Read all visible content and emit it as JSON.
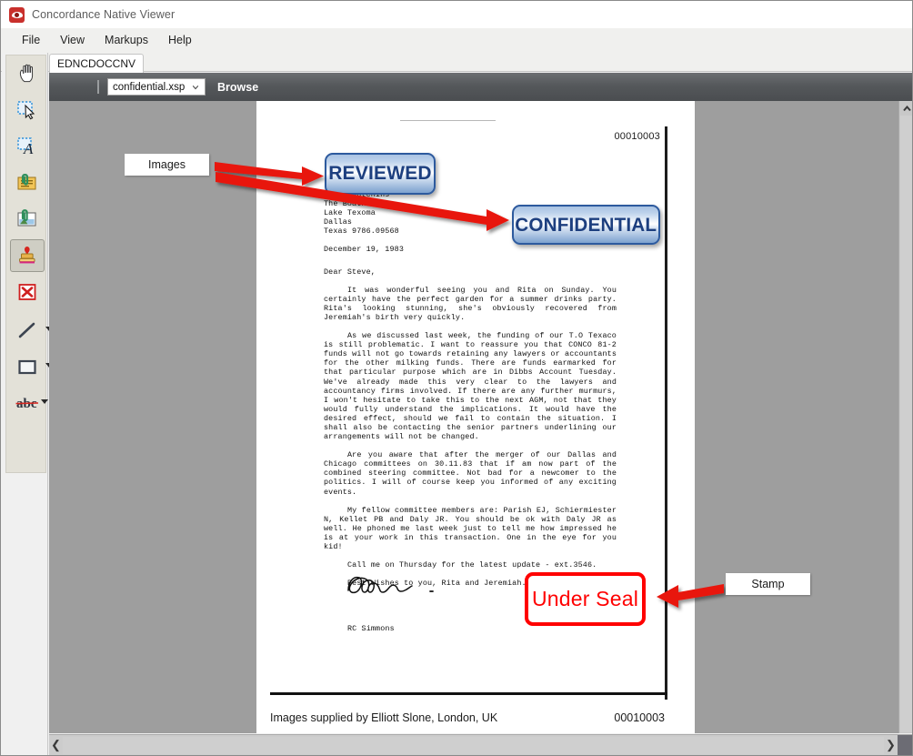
{
  "window": {
    "title": "Concordance Native Viewer",
    "app_icon": "eye-icon"
  },
  "menu": {
    "items": [
      {
        "label": "File",
        "name": "menu-file"
      },
      {
        "label": "View",
        "name": "menu-view"
      },
      {
        "label": "Markups",
        "name": "menu-markups"
      },
      {
        "label": "Help",
        "name": "menu-help"
      }
    ]
  },
  "tabs": [
    {
      "label": "EDNCDOCCNV",
      "active": true
    }
  ],
  "browse_bar": {
    "file_value": "confidential.xsp",
    "browse_label": "Browse",
    "dropdown_icon": "chevron-down-icon"
  },
  "toolbar": {
    "tools": [
      {
        "name": "pan-hand-tool",
        "icon": "hand-icon",
        "selected": false
      },
      {
        "name": "select-region-tool",
        "icon": "select-arrow-icon",
        "selected": false
      },
      {
        "name": "select-text-tool",
        "icon": "text-select-icon",
        "selected": false
      },
      {
        "name": "sticky-note-tool",
        "icon": "note-attach-icon",
        "selected": false
      },
      {
        "name": "image-annotation-tool",
        "icon": "image-stamp-icon",
        "selected": false
      },
      {
        "name": "stamp-tool",
        "icon": "rubber-stamp-icon",
        "selected": true
      },
      {
        "name": "redaction-tool",
        "icon": "red-x-box-icon",
        "selected": false
      },
      {
        "name": "line-tool",
        "icon": "line-icon",
        "selected": false,
        "has_dropdown": true
      },
      {
        "name": "rectangle-tool",
        "icon": "rectangle-icon",
        "selected": false,
        "has_dropdown": true
      },
      {
        "name": "strikeout-tool",
        "icon": "abc-strikeout-icon",
        "selected": false,
        "has_dropdown": true
      }
    ]
  },
  "callouts": [
    {
      "name": "callout-images",
      "label": "Images"
    },
    {
      "name": "callout-stamp",
      "label": "Stamp"
    }
  ],
  "document": {
    "bates_top": "00010003",
    "bates_bottom": "00010003",
    "supplied_by": "Images supplied by Elliott Slone, London, UK",
    "stamps": [
      {
        "name": "stamp-reviewed",
        "label": "REVIEWED",
        "color": "#1d3f7f"
      },
      {
        "name": "stamp-confidential",
        "label": "CONFIDENTIAL",
        "color": "#1d3f7f"
      },
      {
        "name": "stamp-under-seal",
        "label": "Under Seal",
        "color": "#ff0000"
      }
    ],
    "letter": {
      "address_block": "Mr S. Hutchins\nThe Boathouse\nLake Texoma\nDallas\nTexas 9786.09568",
      "date": "December 19, 1983",
      "salutation": "Dear Steve,",
      "paragraph_1": "It was wonderful seeing you and Rita on Sunday.  You certainly have the perfect garden for a summer drinks party.  Rita's looking stunning, she's obviously recovered from Jeremiah's birth very quickly.",
      "paragraph_2": "As we discussed last week, the funding of our T.O Texaco is still problematic.  I want to reassure you that CONCO 81-2 funds will not go towards retaining any lawyers or accountants for the other milking funds.  There are funds earmarked for that particular purpose which are in Dibbs Account Tuesday. We've already made this very clear to the lawyers and accountancy firms involved.  If there are any further murmurs, I won't hesitate to take this to the next AGM, not that they would fully understand the implications.  It would have the desired effect, should we fail to contain the situation.  I shall also be contacting the senior partners underlining our arrangements will not be changed.",
      "paragraph_3": "Are you aware that after the merger of our Dallas and Chicago committees on 30.11.83 that if am now part of the combined steering committee.  Not bad for a newcomer to the politics.  I will of course keep you informed of any exciting events.",
      "paragraph_4": "My fellow committee members are: Parish EJ, Schiermiester N, Kellet PB and Daly JR.  You should be ok with Daly JR as well.  He phoned me last week just to tell me how impressed he is at your work in this transaction.  One in the eye for you kid!",
      "paragraph_5": "Call me on Thursday for the latest update - ext.3546.",
      "closing": "Best Wishes to you, Rita and Jeremiah.",
      "signatory": "RC Simmons"
    }
  },
  "scrollbars": {
    "vertical": {
      "up_icon": "chevron-up-icon"
    },
    "horizontal": {
      "left_icon": "chevron-left-icon",
      "right_icon": "chevron-right-icon"
    }
  },
  "colors": {
    "stamp_blue": "#1d3f7f",
    "stamp_red": "#ff0000",
    "arrow_red": "#e8140c",
    "browse_bar": "#55585b",
    "canvas_gray": "#9e9e9e"
  }
}
